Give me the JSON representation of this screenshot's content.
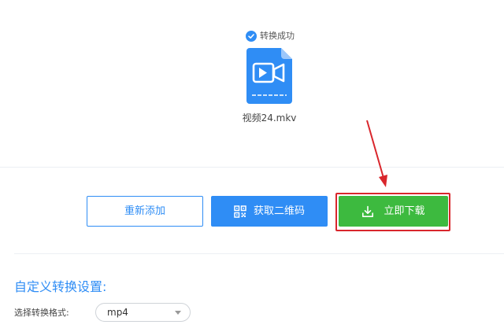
{
  "status": {
    "text": "转换成功",
    "icon": "check-circle-icon"
  },
  "file": {
    "name": "视频24.mkv",
    "icon": "video-file-icon"
  },
  "actions": {
    "readd_label": "重新添加",
    "qr_label": "获取二维码",
    "qr_icon": "qr-code-icon",
    "download_label": "立即下载",
    "download_icon": "download-icon"
  },
  "settings": {
    "title": "自定义转换设置:",
    "format_label": "选择转换格式:",
    "format_value": "mp4"
  },
  "colors": {
    "primary": "#2f8df5",
    "success": "#3dba3f",
    "annotation": "#d9262c"
  }
}
